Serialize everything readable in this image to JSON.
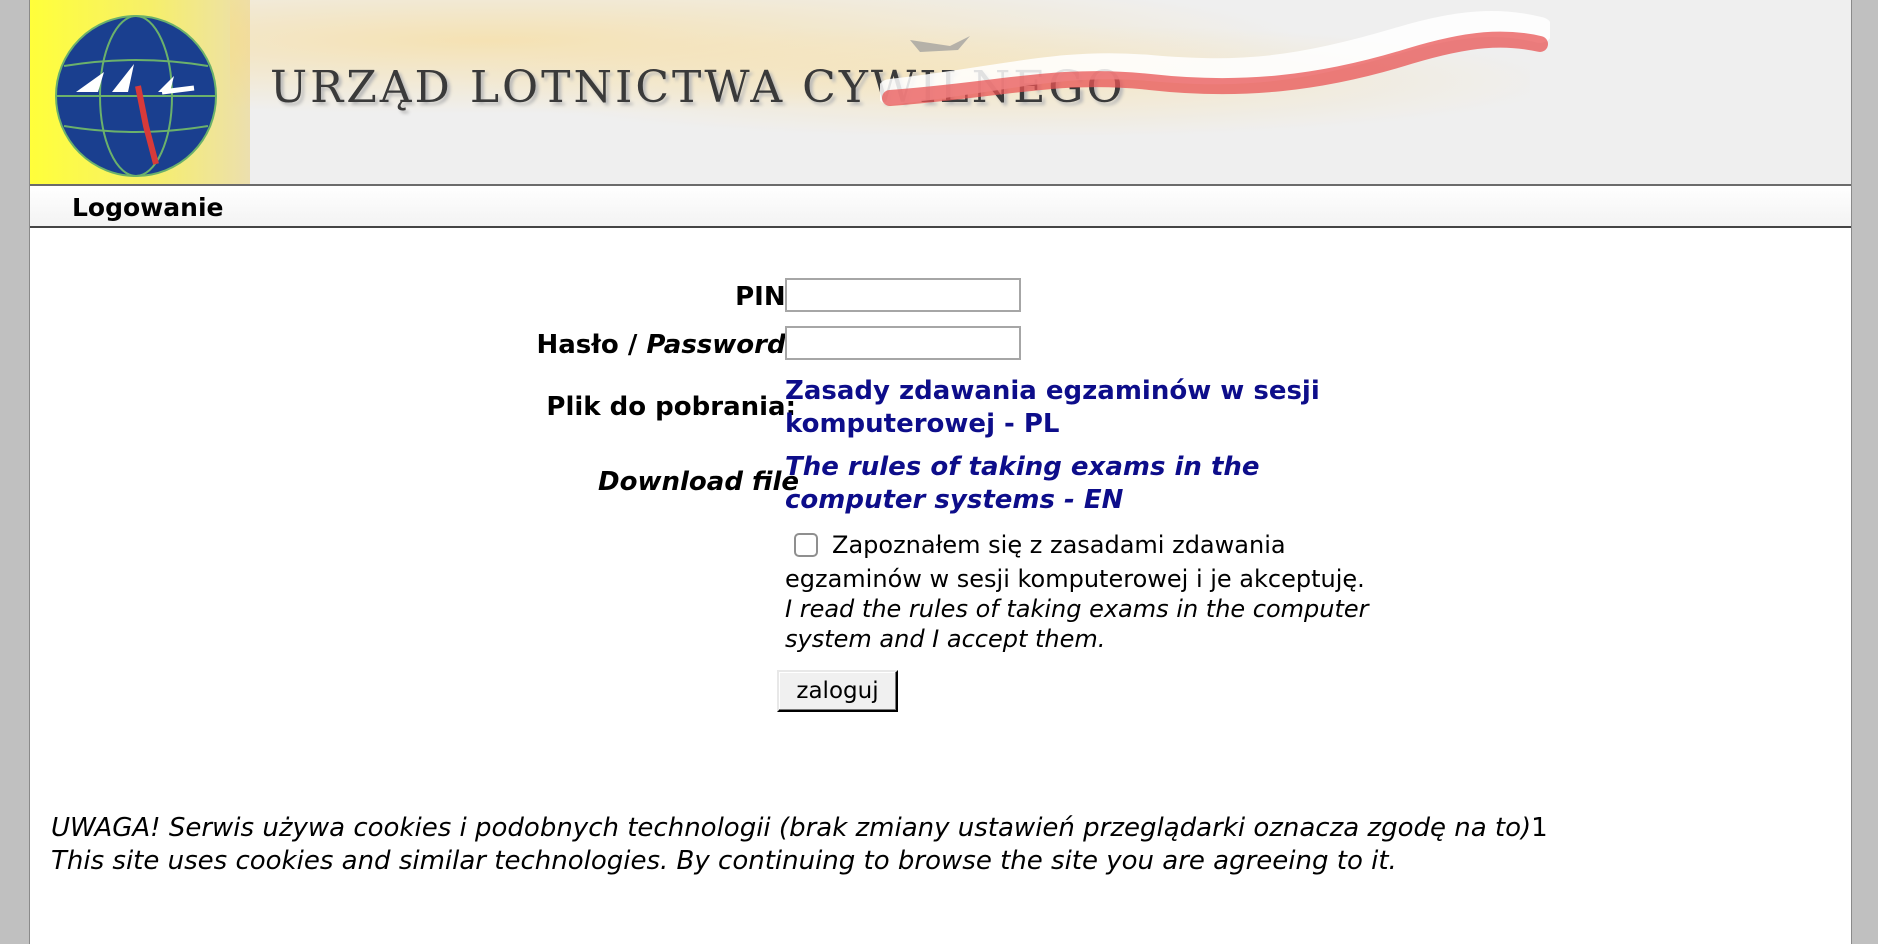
{
  "banner": {
    "title": "URZĄD LOTNICTWA CYWILNEGO",
    "logo_icon": "ulc-globe-logo",
    "colors": {
      "logo_blue": "#1a3f8f",
      "yellow": "#ffff3a",
      "flag_red": "#e85454"
    }
  },
  "section": {
    "title": "Logowanie"
  },
  "form": {
    "pin_label": "PIN:",
    "pin_value": "",
    "password_label_pl": "Hasło / ",
    "password_label_en": "Password",
    "password_label_colon": ":",
    "password_value": "",
    "download_label_pl": "Plik do pobrania:",
    "download_link_pl": "Zasady zdawania egzaminów w sesji komputerowej - PL",
    "download_label_en": "Download file",
    "download_link_en": "The rules of taking exams in the computer systems - EN",
    "accept_pl": "Zapoznałem się z zasadami zdawania egzaminów w sesji komputerowej i je akceptuję.",
    "accept_en": "I read the rules of taking exams in the computer system and I accept them.",
    "accept_checked": false,
    "login_button": "zaloguj"
  },
  "notice": {
    "pl": "UWAGA! Serwis używa cookies i podobnych technologii (brak zmiany ustawień przeglądarki oznacza zgodę na to)",
    "pl_suffix": "1",
    "en": "This site uses cookies and similar technologies. By continuing to browse the site you are agreeing to it."
  },
  "theme": {
    "link_color": "#0d0d8a",
    "background": "#c0c0c0"
  }
}
